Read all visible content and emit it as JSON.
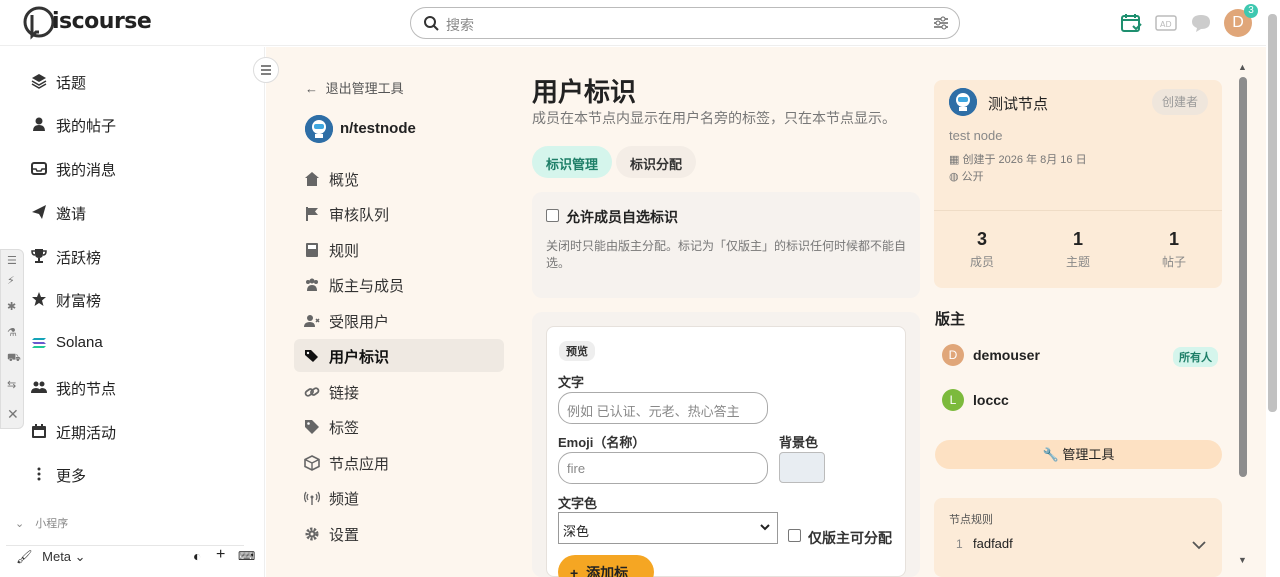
{
  "header": {
    "logo_text": "iscourse",
    "search_placeholder": "搜索",
    "notification_count": "3",
    "avatar_letter": "D"
  },
  "sidebar": {
    "items": [
      {
        "label": "话题",
        "icon": "layers-icon"
      },
      {
        "label": "我的帖子",
        "icon": "user-icon"
      },
      {
        "label": "我的消息",
        "icon": "inbox-icon"
      },
      {
        "label": "邀请",
        "icon": "paper-plane-icon"
      },
      {
        "label": "活跃榜",
        "icon": "trophy-icon"
      },
      {
        "label": "财富榜",
        "icon": "star-icon"
      },
      {
        "label": "Solana",
        "icon": "solana-icon"
      },
      {
        "label": "我的节点",
        "icon": "users-icon"
      },
      {
        "label": "近期活动",
        "icon": "calendar-icon"
      },
      {
        "label": "更多",
        "icon": "ellipsis-icon"
      }
    ],
    "section_label": "小程序",
    "footer_label": "Meta"
  },
  "admin": {
    "back_label": "退出管理工具",
    "node_name": "n/testnode",
    "nav": [
      {
        "label": "概览",
        "icon": "home-icon"
      },
      {
        "label": "审核队列",
        "icon": "flag-icon"
      },
      {
        "label": "规则",
        "icon": "book-icon"
      },
      {
        "label": "版主与成员",
        "icon": "users-icon"
      },
      {
        "label": "受限用户",
        "icon": "user-x-icon"
      },
      {
        "label": "用户标识",
        "icon": "tags-icon",
        "active": true
      },
      {
        "label": "链接",
        "icon": "link-icon"
      },
      {
        "label": "标签",
        "icon": "tag-icon"
      },
      {
        "label": "节点应用",
        "icon": "cube-icon"
      },
      {
        "label": "频道",
        "icon": "broadcast-icon"
      },
      {
        "label": "设置",
        "icon": "gear-icon"
      }
    ]
  },
  "main": {
    "title": "用户标识",
    "subtitle": "成员在本节点内显示在用户名旁的标签，只在本节点显示。",
    "tabs": [
      "标识管理",
      "标识分配"
    ],
    "allow_self_select": {
      "label": "允许成员自选标识",
      "checked": false,
      "description": "关闭时只能由版主分配。标记为「仅版主」的标识任何时候都不能自选。"
    },
    "form": {
      "preview_label": "预览",
      "text_label": "文字",
      "text_placeholder": "例如 已认证、元老、热心答主",
      "emoji_label": "Emoji（名称）",
      "emoji_placeholder": "fire",
      "bg_label": "背景色",
      "bg_color": "#e8edf2",
      "text_color_label": "文字色",
      "text_color_value": "深色",
      "mod_only_label": "仅版主可分配",
      "add_button": "添加标识"
    }
  },
  "right_panel": {
    "node_title": "测试节点",
    "creator_badge": "创建者",
    "description": "test node",
    "created": "创建于 2026 年 8月 16 日",
    "visibility": "公开",
    "stats": [
      {
        "value": "3",
        "label": "成员"
      },
      {
        "value": "1",
        "label": "主题"
      },
      {
        "value": "1",
        "label": "帖子"
      }
    ],
    "moderators_heading": "版主",
    "moderators": [
      {
        "name": "demouser",
        "letter": "D",
        "color": "#e0a679",
        "badge": "所有人"
      },
      {
        "name": "loccc",
        "letter": "L",
        "color": "#7cba3c",
        "badge": ""
      }
    ],
    "tools_button": "管理工具",
    "rules_heading": "节点规则",
    "rules": [
      {
        "num": "1",
        "text": "fadfadf"
      }
    ]
  },
  "colors": {
    "accent_green": "#1e7f68",
    "accent_orange": "#f5a623",
    "panel_bg": "#fdf6ee"
  }
}
